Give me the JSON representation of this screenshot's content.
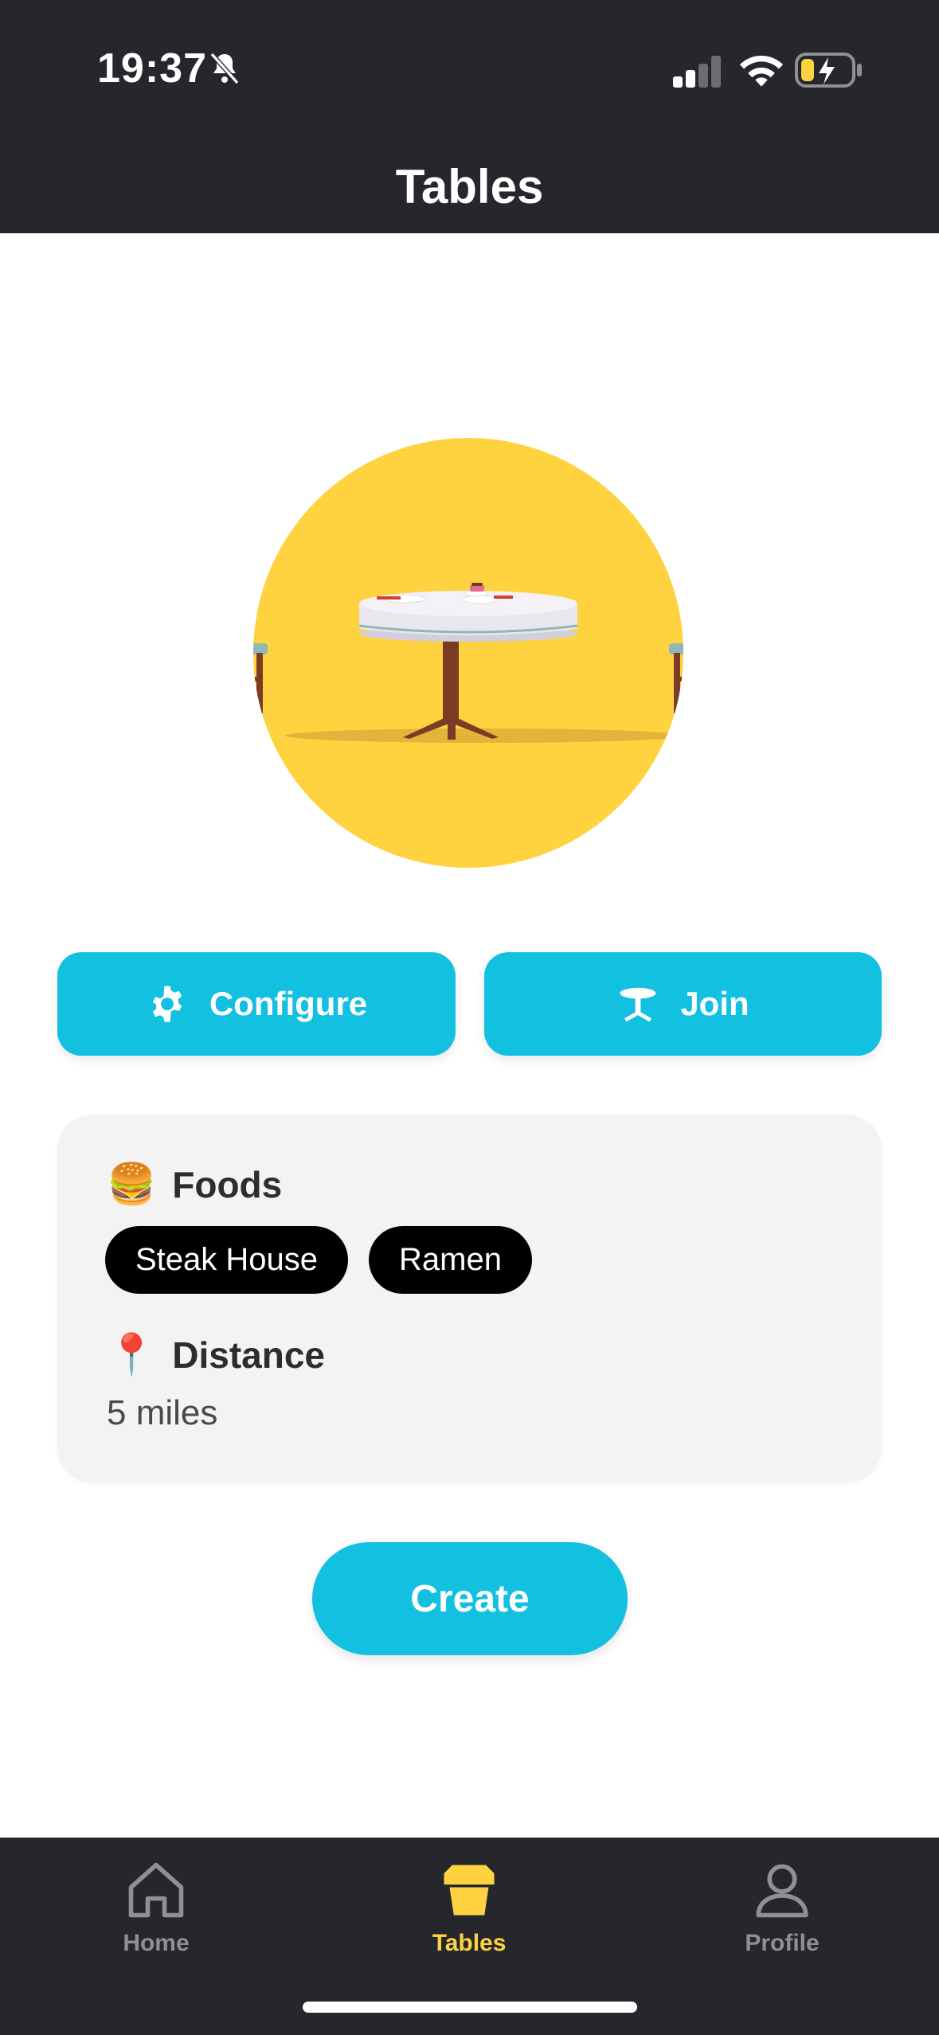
{
  "status_bar": {
    "time": "19:37"
  },
  "header": {
    "title": "Tables"
  },
  "actions": {
    "configure_label": "Configure",
    "join_label": "Join"
  },
  "card": {
    "foods_emoji": "🍔",
    "foods_title": "Foods",
    "foods": [
      "Steak House",
      "Ramen"
    ],
    "distance_emoji": "📍",
    "distance_title": "Distance",
    "distance_value": "5 miles"
  },
  "create_label": "Create",
  "tabbar": {
    "items": [
      {
        "label": "Home",
        "icon": "house-icon"
      },
      {
        "label": "Tables",
        "icon": "table-icon"
      },
      {
        "label": "Profile",
        "icon": "person-icon"
      }
    ],
    "active": "Tables"
  },
  "colors": {
    "accent": "#12c0df",
    "dark": "#25272d",
    "active_tab": "#ffd340",
    "hero_bg": "#ffd340"
  }
}
